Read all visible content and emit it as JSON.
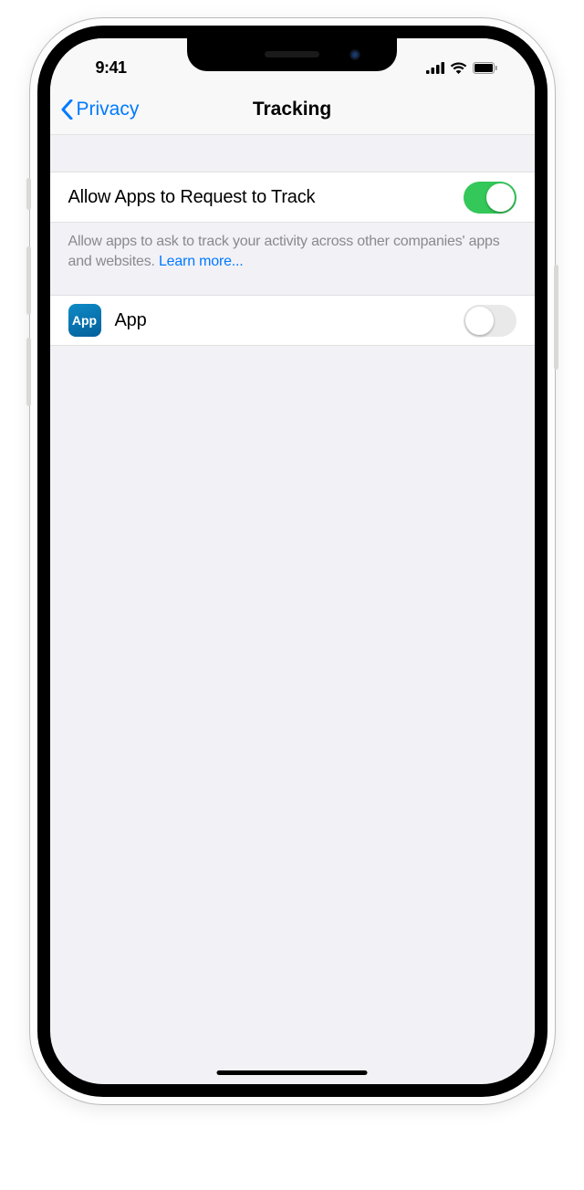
{
  "status": {
    "time": "9:41"
  },
  "nav": {
    "back_label": "Privacy",
    "title": "Tracking"
  },
  "main": {
    "allow_toggle": {
      "label": "Allow Apps to Request to Track",
      "value": true
    },
    "footer_text": "Allow apps to ask to track your activity across other companies' apps and websites. ",
    "learn_more": "Learn more...",
    "apps": [
      {
        "name": "App",
        "icon_text": "App",
        "toggle_value": false
      }
    ]
  }
}
